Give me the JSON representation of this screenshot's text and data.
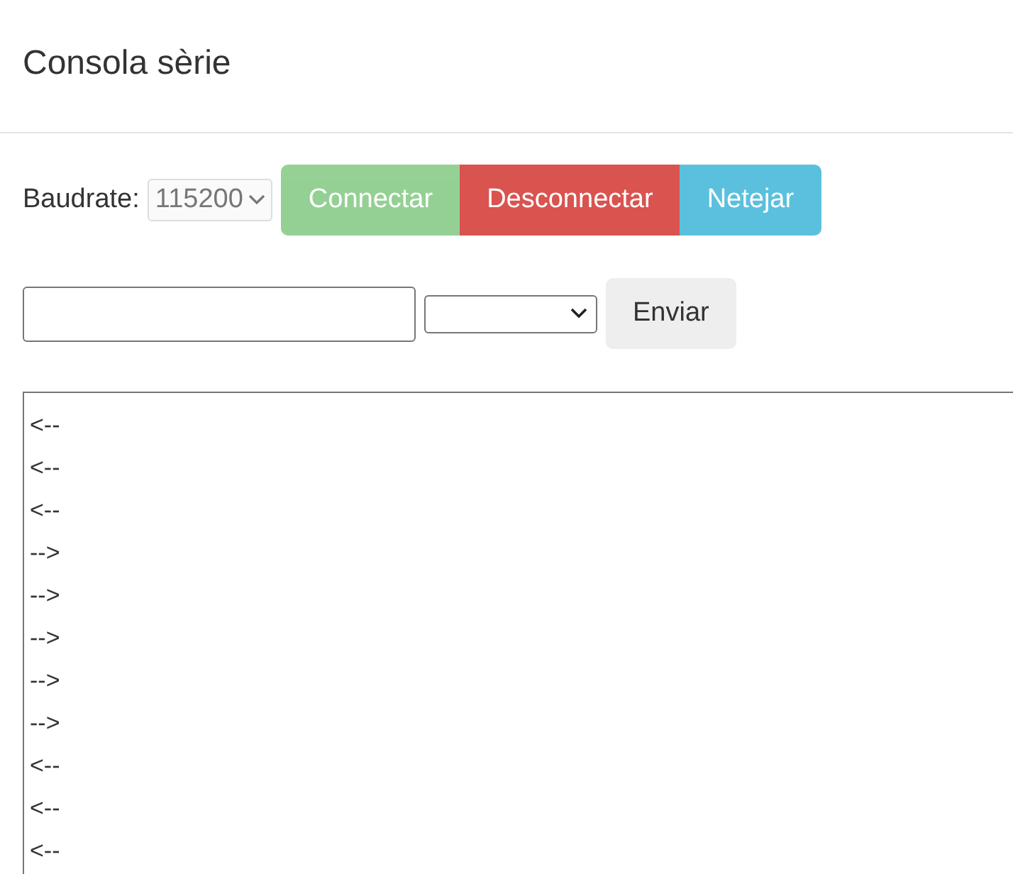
{
  "header": {
    "title": "Consola sèrie"
  },
  "connection": {
    "label": "Baudrate:",
    "baudrate": {
      "value": "115200",
      "disabled": true
    },
    "buttons": [
      {
        "label": "Connectar",
        "kind": "success",
        "disabled": true
      },
      {
        "label": "Desconnectar",
        "kind": "danger",
        "disabled": false
      },
      {
        "label": "Netejar",
        "kind": "info",
        "disabled": false
      }
    ]
  },
  "send": {
    "button": "Enviar"
  },
  "console": {
    "lines": [
      "<--",
      "<--",
      "<--",
      "-->",
      "-->",
      "-->",
      "-->",
      "-->",
      "<--",
      "<--",
      "<--"
    ]
  }
}
